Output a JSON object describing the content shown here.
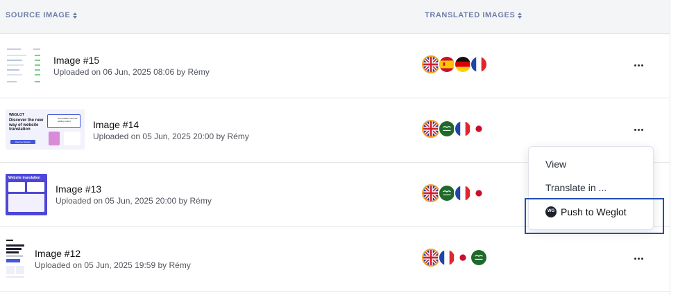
{
  "header": {
    "source_label": "SOURCE IMAGE",
    "translated_label": "TRANSLATED IMAGES"
  },
  "rows": [
    {
      "title": "Image #15",
      "uploaded": "Uploaded on 06 Jun, 2025 08:06 by Rémy",
      "flags": [
        "gb",
        "es",
        "de",
        "fr"
      ]
    },
    {
      "title": "Image #14",
      "uploaded": "Uploaded on 05 Jun, 2025 20:00 by Rémy",
      "flags": [
        "gb",
        "sa",
        "fr",
        "jp"
      ]
    },
    {
      "title": "Image #13",
      "uploaded": "Uploaded on 05 Jun, 2025 20:00 by Rémy",
      "flags": [
        "gb",
        "sa",
        "fr",
        "jp"
      ]
    },
    {
      "title": "Image #12",
      "uploaded": "Uploaded on 05 Jun, 2025 19:59 by Rémy",
      "flags": [
        "gb",
        "fr",
        "jp",
        "sa"
      ]
    }
  ],
  "thumb14": {
    "brand": "WEGLOT",
    "headline": "Discover the new way of website translation",
    "card": "AI translation with full editing control",
    "cta": "Discover Weglot"
  },
  "thumb13": {
    "headline": "Website translation"
  },
  "context_menu": {
    "items": [
      "View",
      "Translate in ...",
      "Push to Weglot"
    ]
  },
  "colors": {
    "accent": "#1f4fb3",
    "header_text": "#6f7fa8",
    "source_ring": "#f0a330"
  }
}
